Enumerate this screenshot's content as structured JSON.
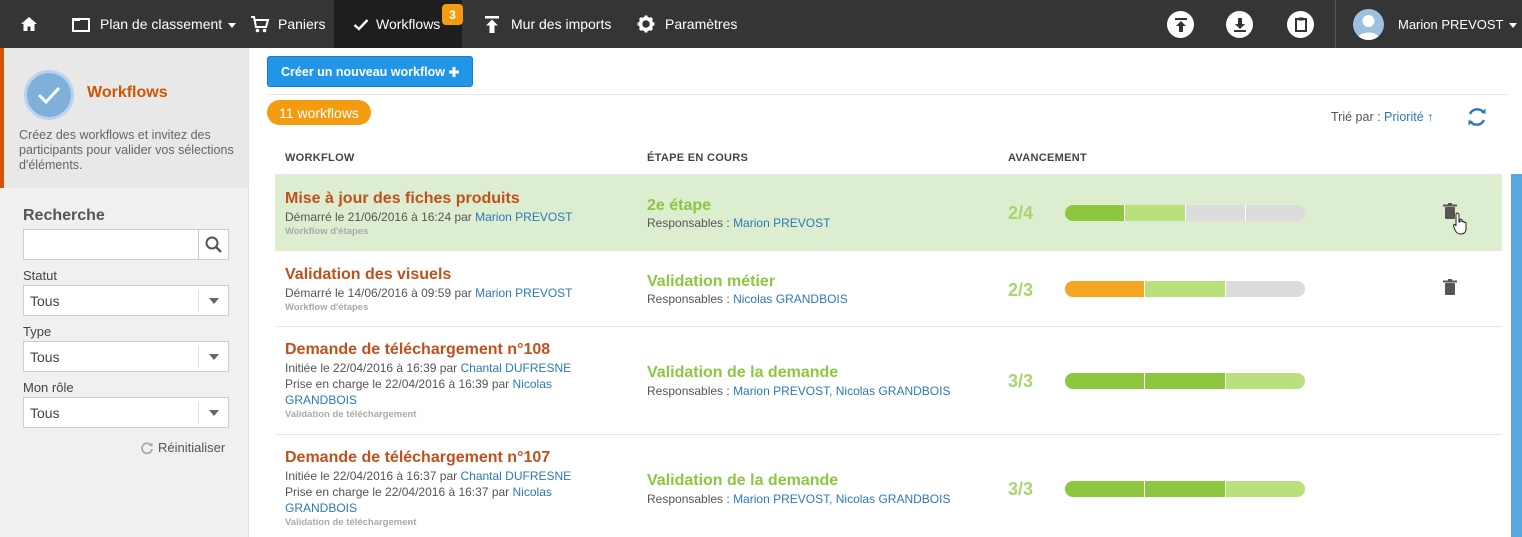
{
  "topnav": {
    "items": [
      {
        "label": "Plan de classement"
      },
      {
        "label": "Paniers"
      },
      {
        "label": "Workflows",
        "badge": "3"
      },
      {
        "label": "Mur des imports"
      },
      {
        "label": "Paramètres"
      }
    ],
    "user": "Marion PREVOST"
  },
  "sidebar": {
    "title": "Workflows",
    "description": "Créez des workflows et invitez des participants pour valider vos sélections d'éléments.",
    "search_title": "Recherche",
    "search_value": "",
    "filters": [
      {
        "label": "Statut",
        "value": "Tous"
      },
      {
        "label": "Type",
        "value": "Tous"
      },
      {
        "label": "Mon rôle",
        "value": "Tous"
      }
    ],
    "reset_label": "Réinitialiser"
  },
  "main": {
    "new_button": "Créer un nouveau workflow",
    "count": "11 workflows",
    "sort_label": "Trié par :",
    "sort_value": "Priorité ↑",
    "columns": [
      "WORKFLOW",
      "ÉTAPE EN COURS",
      "AVANCEMENT"
    ],
    "rows": [
      {
        "title": "Mise à jour des fiches produits",
        "meta1_prefix": "Démarré le 21/06/2016 à 16:24 par",
        "meta1_user": "Marion PREVOST",
        "kind": "Workflow d'étapes",
        "step": "2e étape",
        "resp_label": "Responsables :",
        "resp_users": "Marion PREVOST",
        "progress": "2/4",
        "done": 2,
        "total": 4
      },
      {
        "title": "Validation des visuels",
        "meta1_prefix": "Démarré le 14/06/2016 à 09:59 par",
        "meta1_user": "Marion PREVOST",
        "kind": "Workflow d'étapes",
        "step": "Validation métier",
        "resp_label": "Responsables :",
        "resp_users": "Nicolas GRANDBOIS",
        "progress": "2/3",
        "done": 2,
        "total": 3
      },
      {
        "title": "Demande de téléchargement n°108",
        "meta1_prefix": "Initiée le 22/04/2016 à 16:39 par",
        "meta1_user": "Chantal DUFRESNE",
        "meta2_prefix": "Prise en charge le 22/04/2016 à 16:39 par",
        "meta2_user_a": "Nicolas",
        "meta2_user_b": "GRANDBOIS",
        "kind": "Validation de téléchargement",
        "step": "Validation de la demande",
        "resp_label": "Responsables :",
        "resp_users": "Marion PREVOST, Nicolas GRANDBOIS",
        "progress": "3/3",
        "done": 3,
        "total": 3
      },
      {
        "title": "Demande de téléchargement n°107",
        "meta1_prefix": "Initiée le 22/04/2016 à 16:37 par",
        "meta1_user": "Chantal DUFRESNE",
        "meta2_prefix": "Prise en charge le 22/04/2016 à 16:37 par",
        "meta2_user_a": "Nicolas",
        "meta2_user_b": "GRANDBOIS",
        "kind": "Validation de téléchargement",
        "step": "Validation de la demande",
        "resp_label": "Responsables :",
        "resp_users": "Marion PREVOST, Nicolas GRANDBOIS",
        "progress": "3/3",
        "done": 3,
        "total": 3
      }
    ]
  }
}
